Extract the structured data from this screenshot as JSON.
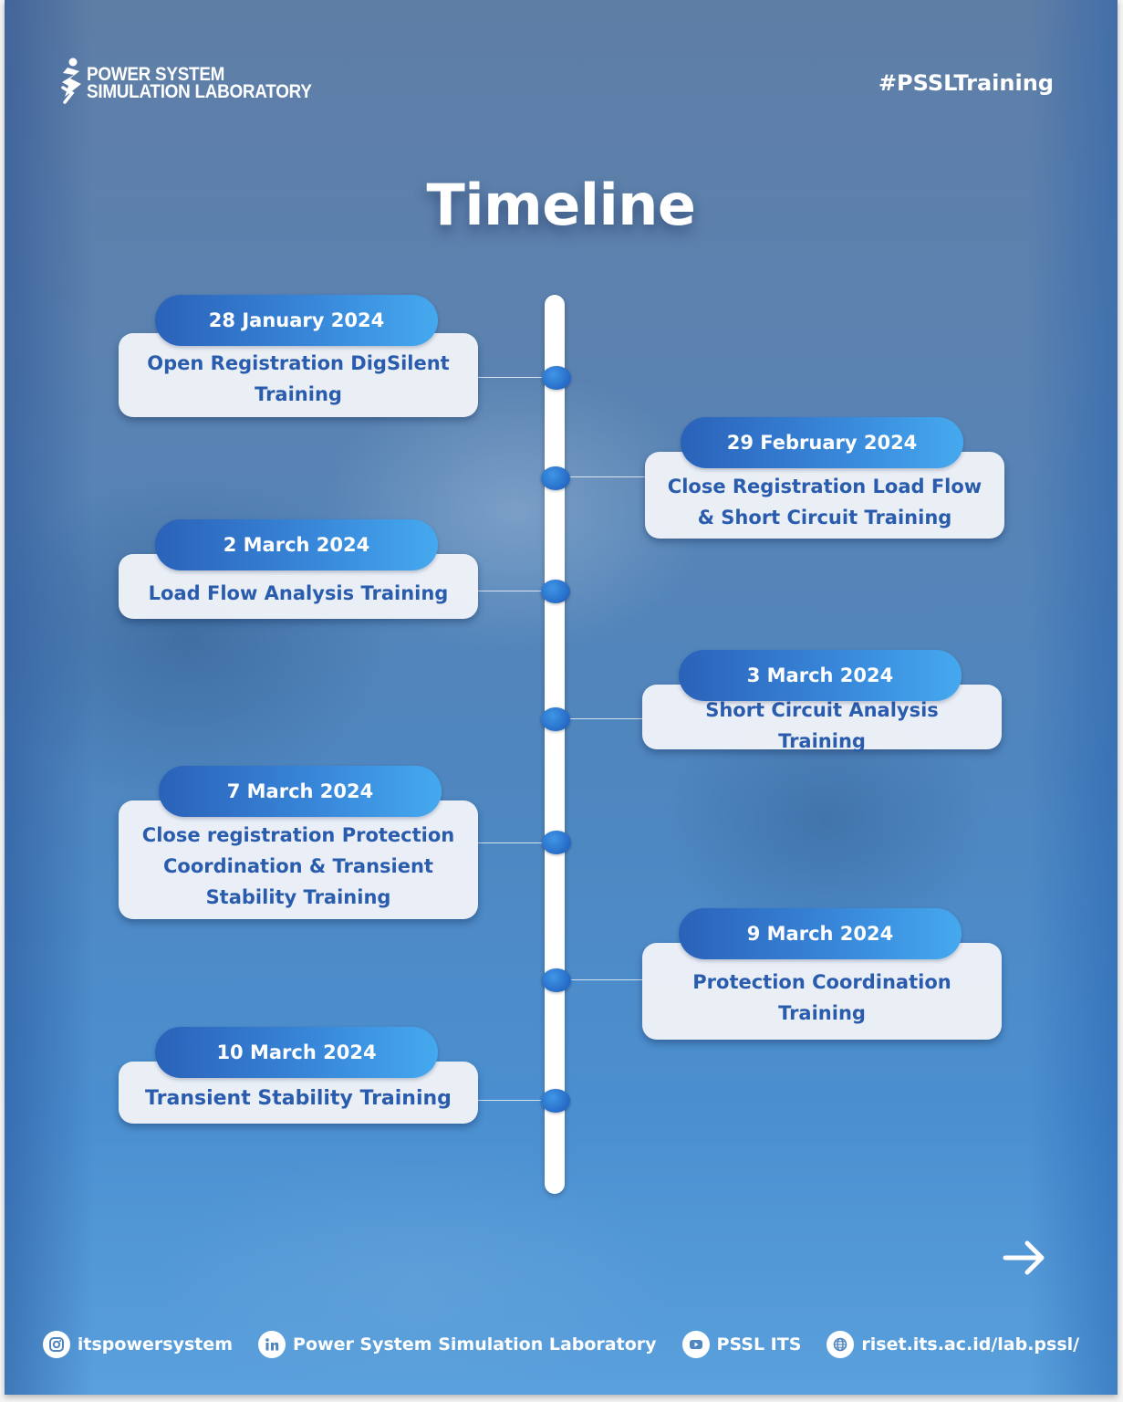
{
  "brand": {
    "logo_line1": "POWER SYSTEM",
    "logo_line2": "SIMULATION LABORATORY",
    "hashtag": "#PSSLTraining",
    "logo_icon": "running-figure-s-logo"
  },
  "page": {
    "title": "Timeline"
  },
  "colors": {
    "background_blue": "#4f86bf",
    "pill_gradient_start": "#2a62b9",
    "pill_gradient_end": "#45a9ef",
    "card_text": "#2a5cae",
    "card_background": "#f0f3f8",
    "spine": "#ffffff",
    "dot": "#2f7ed6"
  },
  "timeline": {
    "events": [
      {
        "date": "28 January 2024",
        "title": "Open Registration DigSilent Training",
        "side": "left"
      },
      {
        "date": "29 February 2024",
        "title": "Close Registration Load Flow & Short Circuit Training",
        "side": "right"
      },
      {
        "date": "2 March 2024",
        "title": "Load Flow Analysis Training",
        "side": "left"
      },
      {
        "date": "3 March 2024",
        "title": "Short Circuit Analysis Training",
        "side": "right"
      },
      {
        "date": "7 March 2024",
        "title": "Close registration Protection Coordination & Transient Stability Training",
        "side": "left"
      },
      {
        "date": "9 March 2024",
        "title": "Protection Coordination Training",
        "side": "right"
      },
      {
        "date": "10 March 2024",
        "title": "Transient Stability Training",
        "side": "left"
      }
    ]
  },
  "navigation": {
    "next_icon": "arrow-right-icon"
  },
  "footer": {
    "socials": [
      {
        "icon": "instagram-icon",
        "label": "itspowersystem"
      },
      {
        "icon": "linkedin-icon",
        "label": "Power System Simulation Laboratory"
      },
      {
        "icon": "youtube-icon",
        "label": "PSSL ITS"
      },
      {
        "icon": "globe-icon",
        "label": "riset.its.ac.id/lab.pssl/"
      }
    ]
  }
}
